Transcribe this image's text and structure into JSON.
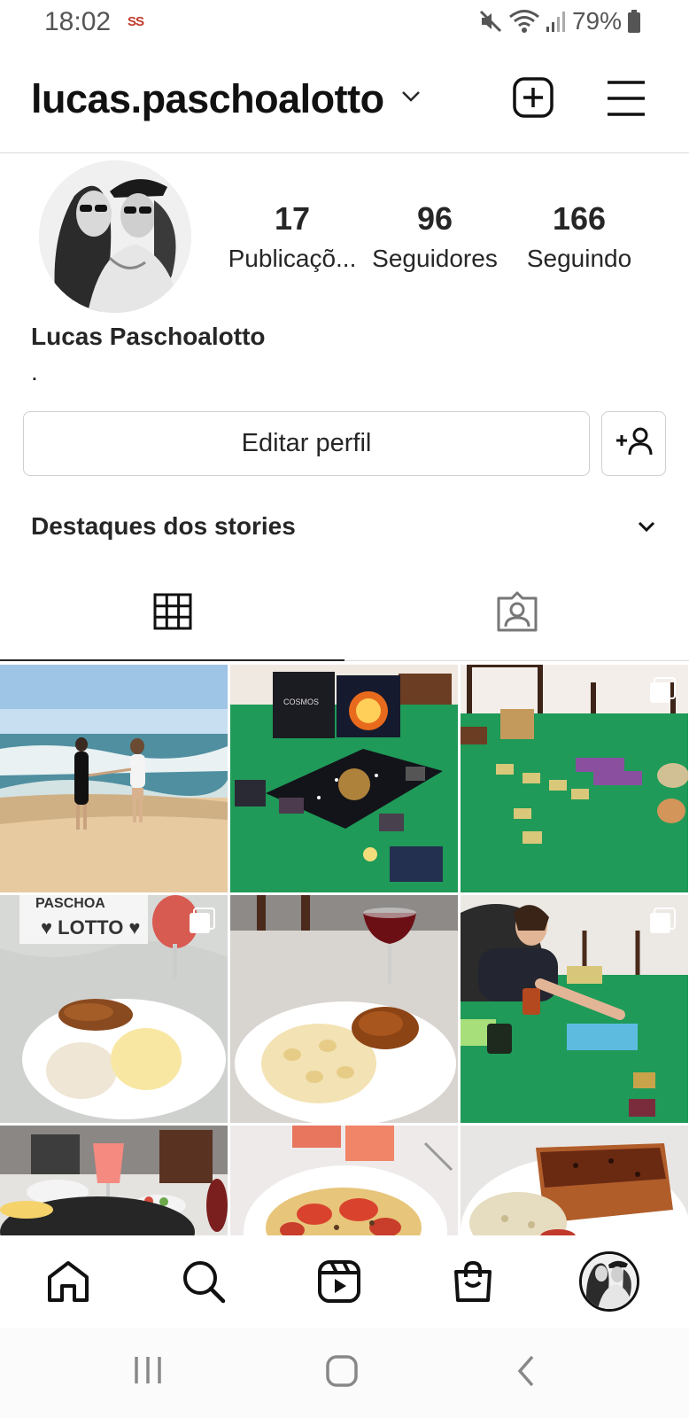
{
  "status_bar": {
    "time": "18:02",
    "carrier_logo": "SS",
    "battery_percent": "79%",
    "icons": [
      "mute-icon",
      "wifi-icon",
      "signal-icon",
      "battery-icon"
    ]
  },
  "header": {
    "username": "lucas.paschoalotto",
    "icons": [
      "chevron-down-icon",
      "new-post-icon",
      "menu-icon"
    ]
  },
  "profile": {
    "stats": [
      {
        "value": "17",
        "label": "Publicaçõ..."
      },
      {
        "value": "96",
        "label": "Seguidores"
      },
      {
        "value": "166",
        "label": "Seguindo"
      }
    ],
    "full_name": "Lucas Paschoalotto",
    "bio": ".",
    "edit_button": "Editar perfil",
    "highlights_label": "Destaques dos stories"
  },
  "tabs": [
    {
      "name": "posts-grid",
      "icon": "grid-icon",
      "active": true
    },
    {
      "name": "tagged",
      "icon": "tagged-person-icon",
      "active": false
    }
  ],
  "posts": [
    {
      "subject": "beach-couple",
      "multi": false
    },
    {
      "subject": "cosmos-board-game",
      "multi": false,
      "text": "COSMOS"
    },
    {
      "subject": "board-game-table",
      "multi": true
    },
    {
      "subject": "meal-schnitzel-rice",
      "multi": true,
      "text": "PASCHOA LOTTO"
    },
    {
      "subject": "meal-pasta-wine",
      "multi": false
    },
    {
      "subject": "man-playing-board-game",
      "multi": true
    },
    {
      "subject": "pizza-table",
      "multi": false
    },
    {
      "subject": "pizza-tomato",
      "multi": false
    },
    {
      "subject": "lasagna-risotto",
      "multi": false
    }
  ],
  "bottom_nav": [
    "home-icon",
    "search-icon",
    "reels-icon",
    "shop-icon",
    "profile-avatar"
  ],
  "colors": {
    "text": "#262626",
    "border": "#dbdbdb",
    "table_green": "#1f9a58"
  }
}
